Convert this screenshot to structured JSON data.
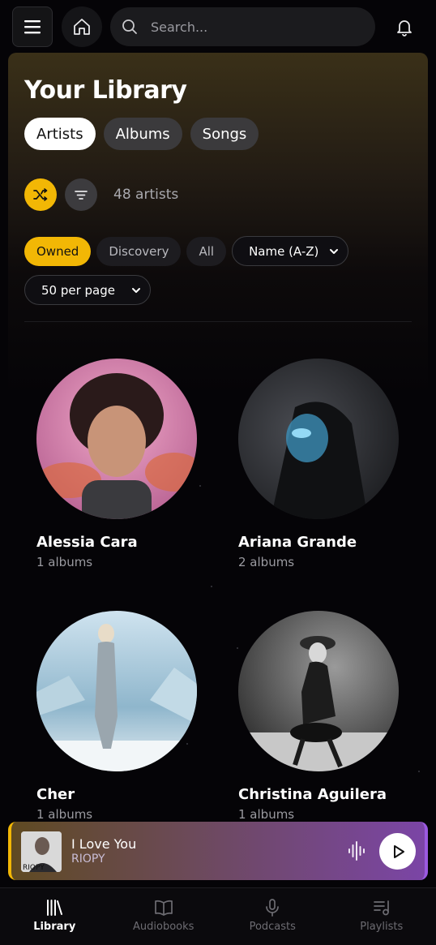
{
  "header": {
    "search_placeholder": "Search..."
  },
  "library": {
    "title": "Your Library",
    "tabs": [
      {
        "label": "Artists",
        "active": true
      },
      {
        "label": "Albums",
        "active": false
      },
      {
        "label": "Songs",
        "active": false
      }
    ],
    "count_text": "48 artists",
    "filters": [
      {
        "label": "Owned",
        "active": true
      },
      {
        "label": "Discovery",
        "active": false
      },
      {
        "label": "All",
        "active": false
      }
    ],
    "sort_value": "Name (A-Z)",
    "page_size_value": "50 per page"
  },
  "artists": [
    {
      "name": "Alessia Cara",
      "albums": "1 albums"
    },
    {
      "name": "Ariana Grande",
      "albums": "2 albums"
    },
    {
      "name": "Cher",
      "albums": "1 albums"
    },
    {
      "name": "Christina Aguilera",
      "albums": "1 albums"
    }
  ],
  "player": {
    "song": "I Love You",
    "artist": "RIOPY",
    "cover_text": "RIOPY"
  },
  "nav": [
    {
      "label": "Library",
      "active": true
    },
    {
      "label": "Audiobooks",
      "active": false
    },
    {
      "label": "Podcasts",
      "active": false
    },
    {
      "label": "Playlists",
      "active": false
    }
  ],
  "colors": {
    "accent": "#f2b705",
    "player_gradient_end": "#7b45a6"
  }
}
